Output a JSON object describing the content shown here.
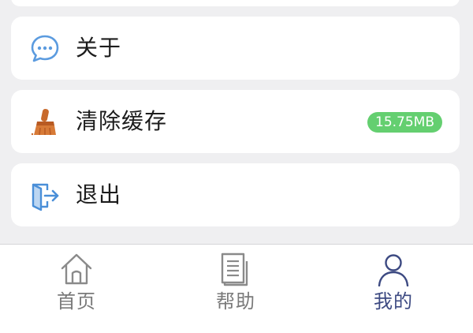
{
  "menu": {
    "items": [
      {
        "label": "关于",
        "icon": "chat-bubble-icon"
      },
      {
        "label": "清除缓存",
        "icon": "broom-icon",
        "badge": "15.75MB"
      },
      {
        "label": "退出",
        "icon": "exit-door-icon"
      }
    ]
  },
  "tabbar": {
    "tabs": [
      {
        "label": "首页",
        "icon": "home-icon",
        "active": false
      },
      {
        "label": "帮助",
        "icon": "document-icon",
        "active": false
      },
      {
        "label": "我的",
        "icon": "user-icon",
        "active": true
      }
    ]
  },
  "colors": {
    "background": "#efeff1",
    "badge": "#64cf70",
    "active_tab": "#3d4a82",
    "inactive_tab": "#7a7a7a",
    "chat_icon": "#5b9bdf",
    "broom_icon": "#c86a2c",
    "exit_icon": "#4a8fd8"
  }
}
